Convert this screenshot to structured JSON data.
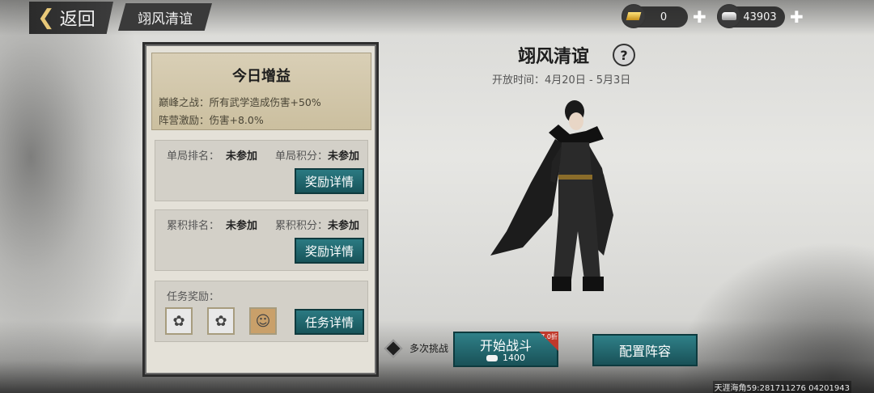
{
  "header": {
    "back_label": "返回",
    "title_tab": "翊风清谊"
  },
  "currency": {
    "gold": {
      "icon": "gold-ingot-icon",
      "value": "0"
    },
    "silver": {
      "icon": "silver-ingot-icon",
      "value": "43903"
    }
  },
  "buff": {
    "title": "今日增益",
    "line1": "巅峰之战：所有武学造成伤害+50%",
    "line2": "阵营激励：伤害+8.0%"
  },
  "single": {
    "rank_label": "单局排名：",
    "rank_value": "未参加",
    "score_label": "单局积分：",
    "score_value": "未参加",
    "button": "奖励详情"
  },
  "cumulative": {
    "rank_label": "累积排名：",
    "rank_value": "未参加",
    "score_label": "累积积分：",
    "score_value": "未参加",
    "button": "奖励详情"
  },
  "task": {
    "label": "任务奖励：",
    "button": "任务详情",
    "rewards": [
      "reward-item-icon",
      "reward-item-icon",
      "reward-portrait-icon"
    ]
  },
  "event": {
    "title": "翊风清谊",
    "open_time": "开放时间：4月20日 - 5月3日"
  },
  "actions": {
    "multi_challenge": "多次挑战",
    "start_battle": "开始战斗",
    "start_cost": "1400",
    "discount": "7.0折",
    "configure": "配置阵容"
  },
  "watermark": "天涯海角59:281711276 04201943",
  "colors": {
    "teal_button": "#2b7a82",
    "panel_bg": "#e4e1d8",
    "buff_bg": "#d9cfb6",
    "gold_accent": "#e9c979",
    "discount_red": "#c0392b"
  }
}
